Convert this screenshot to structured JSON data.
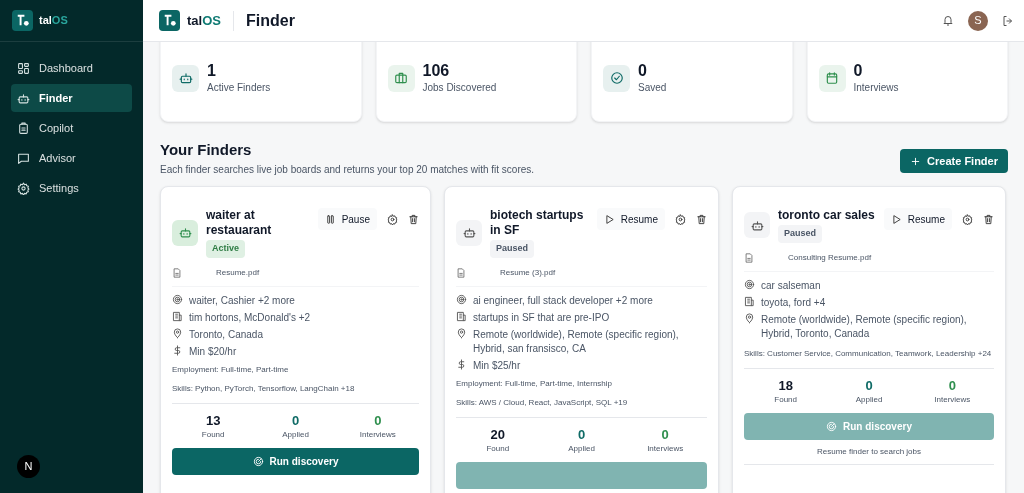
{
  "sidebar": {
    "brand_parts": [
      "tal",
      "OS"
    ],
    "items": [
      {
        "label": "Dashboard",
        "kind": "grid",
        "selected": false
      },
      {
        "label": "Finder",
        "kind": "bot",
        "selected": true
      },
      {
        "label": "Copilot",
        "kind": "clipboard",
        "selected": false
      },
      {
        "label": "Advisor",
        "kind": "chat",
        "selected": false
      },
      {
        "label": "Settings",
        "kind": "gear",
        "selected": false
      }
    ],
    "dev_badge": "N"
  },
  "header": {
    "brand_parts": [
      "tal",
      "OS"
    ],
    "title": "Finder",
    "avatar": "S"
  },
  "stats": [
    {
      "value": "1",
      "label": "Active Finders",
      "kind": "bot",
      "color": "#0f6b66"
    },
    {
      "value": "106",
      "label": "Jobs Discovered",
      "kind": "briefcase",
      "color": "#2f8f4e"
    },
    {
      "value": "0",
      "label": "Saved",
      "kind": "check",
      "color": "#0f6b66"
    },
    {
      "value": "0",
      "label": "Interviews",
      "kind": "calendar",
      "color": "#2f8f4e"
    }
  ],
  "section": {
    "title": "Your Finders",
    "subtitle": "Each finder searches live job boards and returns your top 20 matches with fit scores.",
    "create_button": "Create Finder"
  },
  "finders": [
    {
      "name": "waiter at restauarant",
      "active": true,
      "status_label": "Active",
      "toggle_label": "Pause",
      "resume_file": "Resume.pdf",
      "criteria": [
        {
          "kind": "role",
          "text": "waiter, Cashier +2 more"
        },
        {
          "kind": "company",
          "text": "tim hortons, McDonald's +2"
        },
        {
          "kind": "location",
          "text": "Toronto, Canada"
        },
        {
          "kind": "salary",
          "text": "Min $20/hr"
        }
      ],
      "employment": "Employment: Full-time, Part-time",
      "skills": "Skills: Python, PyTorch, Tensorflow, LangChain +18",
      "found": "13",
      "found_label": "Found",
      "applied": "0",
      "applied_label": "Applied",
      "interviews": "0",
      "interviews_label": "Interviews",
      "run_label": "Run discovery",
      "run_disabled": false
    },
    {
      "name": "biotech startups in SF",
      "active": false,
      "status_label": "Paused",
      "toggle_label": "Resume",
      "resume_file": "Resume (3).pdf",
      "criteria": [
        {
          "kind": "role",
          "text": "ai engineer, full stack developer +2 more"
        },
        {
          "kind": "company",
          "text": "startups in SF that are pre-IPO"
        },
        {
          "kind": "location",
          "text": "Remote (worldwide), Remote (specific region), Hybrid, san fransisco, CA"
        },
        {
          "kind": "salary",
          "text": "Min $25/hr"
        }
      ],
      "employment": "Employment: Full-time, Part-time, Internship",
      "skills": "Skills: AWS / Cloud, React, JavaScript, SQL +19",
      "found": "20",
      "found_label": "Found",
      "applied": "0",
      "applied_label": "Applied",
      "interviews": "0",
      "interviews_label": "Interviews",
      "run_disabled": true
    },
    {
      "name": "toronto car sales",
      "active": false,
      "status_label": "Paused",
      "toggle_label": "Resume",
      "resume_file": "Consulting Resume.pdf",
      "criteria": [
        {
          "kind": "role",
          "text": "car salseman"
        },
        {
          "kind": "company",
          "text": "toyota, ford +4"
        },
        {
          "kind": "location",
          "text": "Remote (worldwide), Remote (specific region), Hybrid, Toronto, Canada"
        }
      ],
      "skills": "Skills: Customer Service, Communication, Teamwork, Leadership +24",
      "found": "18",
      "found_label": "Found",
      "applied": "0",
      "applied_label": "Applied",
      "interviews": "0",
      "interviews_label": "Interviews",
      "run_label": "Run discovery",
      "run_disabled": true,
      "run_note": "Resume finder to search jobs"
    }
  ]
}
